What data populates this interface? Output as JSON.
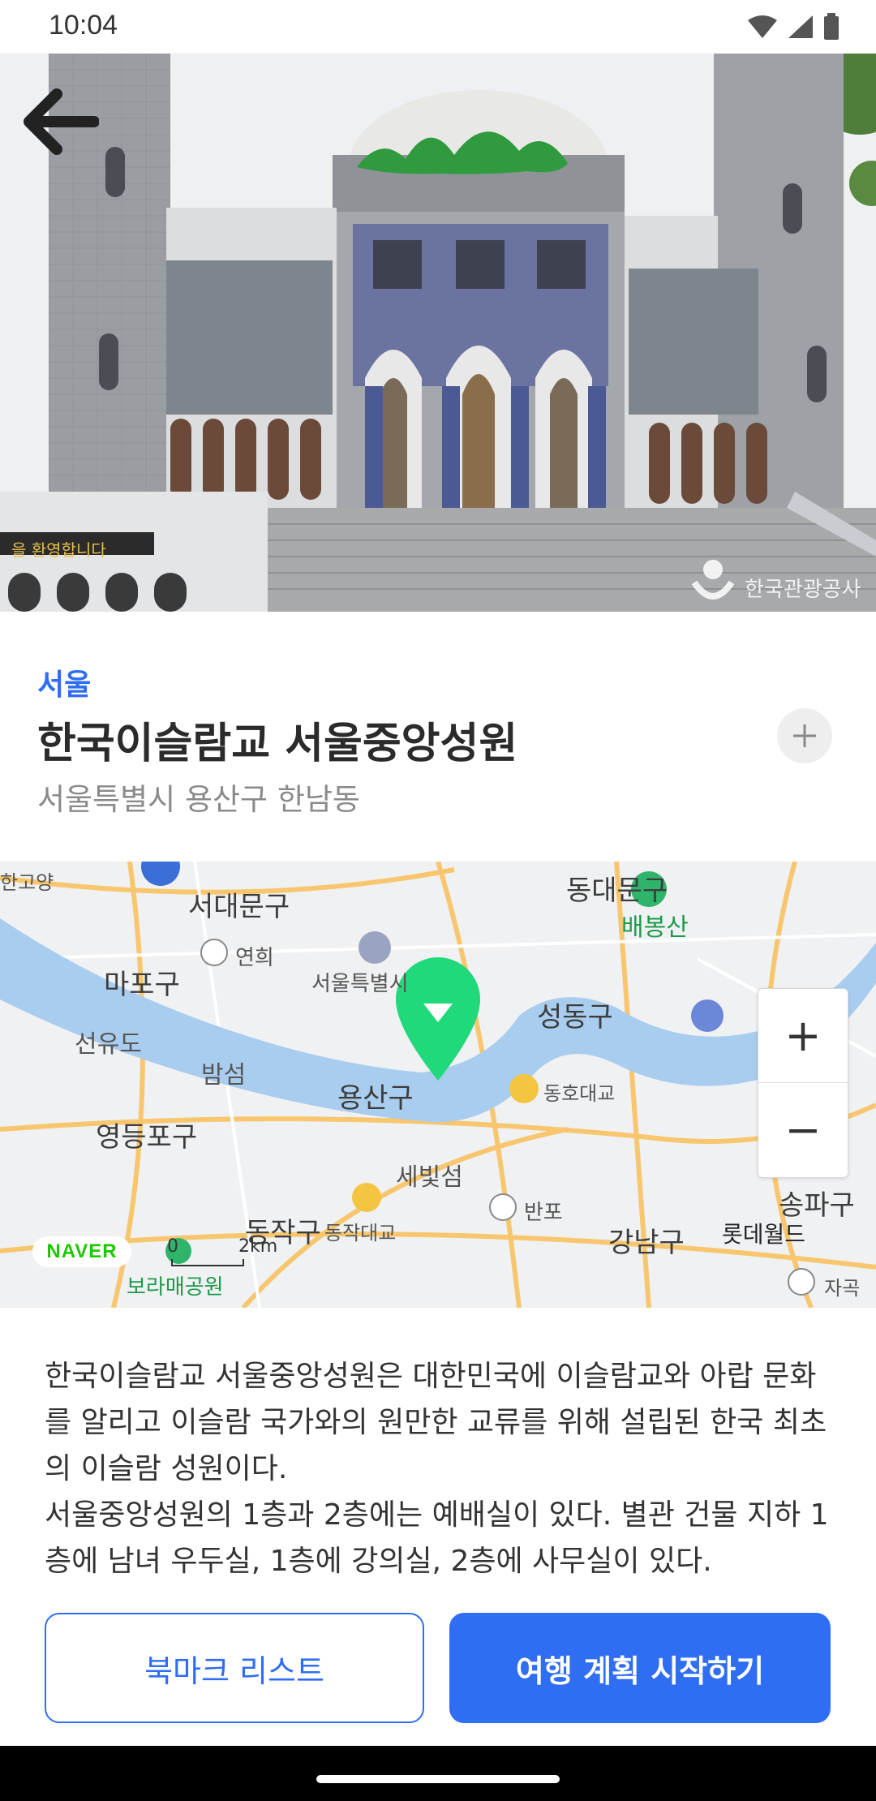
{
  "status": {
    "time": "10:04"
  },
  "hero": {
    "image_alt": "mosque",
    "watermark": "한국관광공사",
    "sign_text": "을 환영합니다"
  },
  "place": {
    "region": "서울",
    "title": "한국이슬람교 서울중앙성원",
    "address": "서울특별시 용산구 한남동"
  },
  "map": {
    "labels": [
      "서대문구",
      "동대문구",
      "배봉산",
      "연희",
      "마포구",
      "서울특별시",
      "성동구",
      "선유도",
      "밤섬",
      "용산구",
      "동호대교",
      "영등포구",
      "세빛섬",
      "반포",
      "동작구",
      "동작대교",
      "강남구",
      "송파구",
      "롯데월드",
      "보라매공원",
      "자곡",
      "한고양"
    ],
    "logo": "NAVER",
    "scale": "2km",
    "scale_zero": "0",
    "zoom_in": "+",
    "zoom_out": "−"
  },
  "description": {
    "para1": "한국이슬람교 서울중앙성원은 대한민국에 이슬람교와 아랍 문화를 알리고 이슬람 국가와의 원만한 교류를 위해 설립된 한국 최초의 이슬람 성원이다.",
    "para2": "서울중앙성원의 1층과 2층에는 예배실이 있다. 별관 건물 지하 1층에 남녀 우두실, 1층에 강의실, 2층에 사무실이 있다."
  },
  "actions": {
    "bookmark_label": "북마크 리스트",
    "start_label": "여행 계획 시작하기"
  },
  "colors": {
    "accent": "#2f6ef2",
    "marker": "#1fd97a"
  }
}
